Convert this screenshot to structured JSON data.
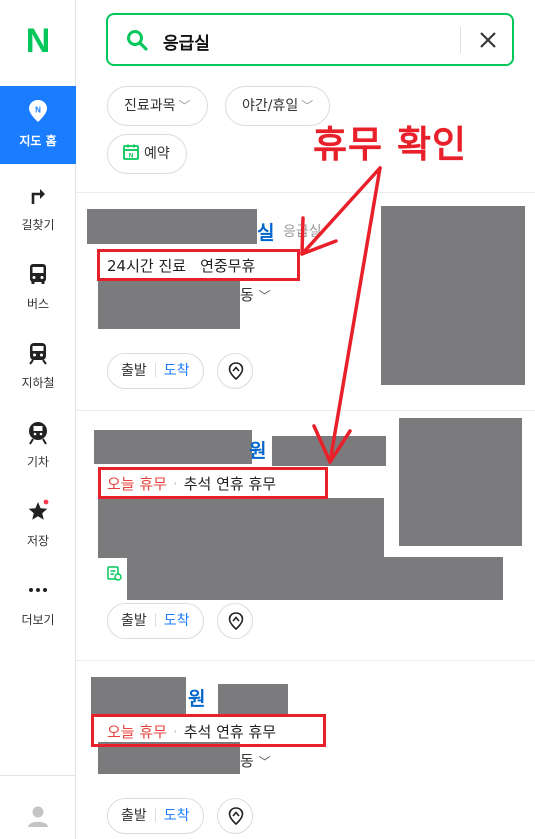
{
  "sidebar": {
    "logo": "N",
    "items": [
      {
        "label": "지도 홈",
        "icon": "map-pin-icon"
      },
      {
        "label": "길찾기",
        "icon": "route-icon"
      },
      {
        "label": "버스",
        "icon": "bus-icon"
      },
      {
        "label": "지하철",
        "icon": "subway-icon"
      },
      {
        "label": "기차",
        "icon": "train-icon"
      },
      {
        "label": "저장",
        "icon": "star-icon"
      },
      {
        "label": "더보기",
        "icon": "more-icon"
      }
    ],
    "active_index": 0,
    "accent": "#1a7cff",
    "brand": "#03c75a"
  },
  "search": {
    "query": "응급실"
  },
  "filters": {
    "department": "진료과목",
    "night_holiday": "야간/휴일",
    "reservation": "예약"
  },
  "results": [
    {
      "name_visible": "실",
      "category": "응급실",
      "info": {
        "hours": "24시간 진료",
        "note": "연중무휴"
      },
      "address_tail": "동"
    },
    {
      "name_visible": "원",
      "info": {
        "status": "오늘 휴무",
        "note": "추석 연휴 휴무"
      }
    },
    {
      "name_visible": "원",
      "info": {
        "status": "오늘 휴무",
        "note": "추석 연휴 휴무"
      },
      "address_tail": "동"
    }
  ],
  "actions": {
    "start": "출발",
    "arrive": "도착"
  },
  "annotation": {
    "text": "휴무 확인",
    "color": "#e8202a"
  }
}
